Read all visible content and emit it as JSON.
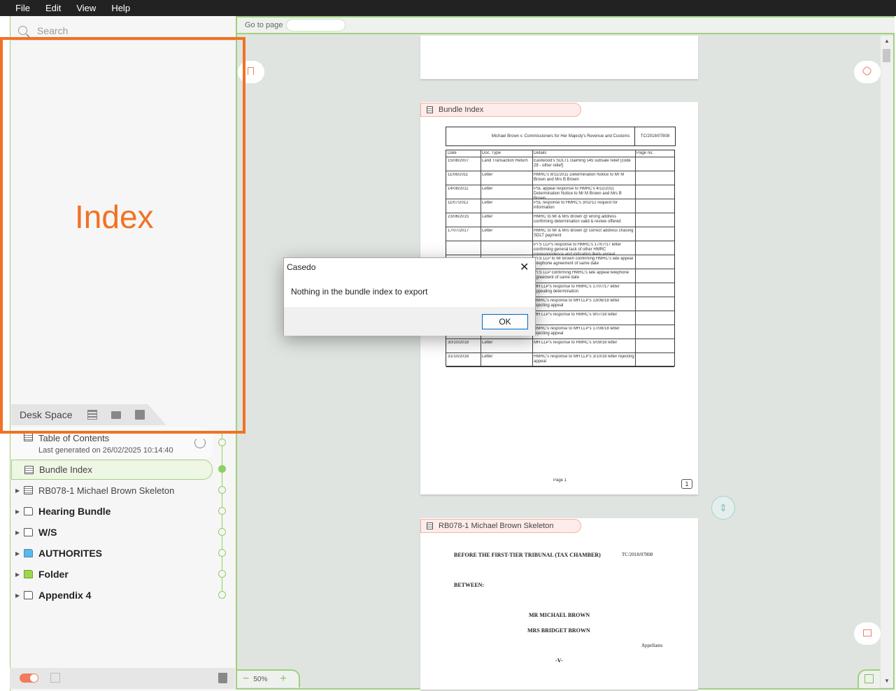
{
  "menu": [
    "File",
    "Edit",
    "View",
    "Help"
  ],
  "search": {
    "placeholder": "Search"
  },
  "overlay_label": "Index",
  "desk_space": {
    "label": "Desk Space"
  },
  "tree": {
    "toc": {
      "label": "Table of Contents",
      "subtitle": "Last generated on 26/02/2025 10:14:40"
    },
    "items": [
      {
        "label": "Bundle Index",
        "type": "doc",
        "selected": true
      },
      {
        "label": "RB078-1 Michael Brown Skeleton",
        "type": "doc"
      },
      {
        "label": "Hearing Bundle",
        "type": "folder"
      },
      {
        "label": "W/S",
        "type": "folder"
      },
      {
        "label": "AUTHORITES",
        "type": "folder",
        "color": "#5bb8e8"
      },
      {
        "label": "Folder",
        "type": "folder",
        "color": "#9fd74c"
      },
      {
        "label": "Appendix 4",
        "type": "folder"
      }
    ]
  },
  "viewer": {
    "goto_label": "Go to page",
    "zoom": "50%",
    "page1": {
      "tab_label": "Bundle Index",
      "scan_title": "Michael Brown v. Commissioners for Her Majesty's Revenue and Customs",
      "scan_ref": "TC/2018/07808",
      "columns": [
        "Date",
        "Doc. Type",
        "Details",
        "Page no."
      ],
      "rows": [
        {
          "date": "15/08/2007",
          "type": "Land Transaction Return",
          "details": "Eastwood's SDLT1 claiming s45 subsale relief [code 28 - other relief]"
        },
        {
          "date": "11/08/2011",
          "type": "Letter",
          "details": "HMRC's 8/11/2011 Determination Notice to Mr M Brown and Mrs B Brown"
        },
        {
          "date": "14/08/2011",
          "type": "Letter",
          "details": "PSL appeal response to HMRC's 4/11/2011 Determination Notice to Mr M Brown and Mrs B Brown"
        },
        {
          "date": "11/07/2012",
          "type": "Letter",
          "details": "PSL response to HMRC's 3/02/12 request for information"
        },
        {
          "date": "23/06/2015",
          "type": "Letter",
          "details": "HMRC to Mr & Mrs Brown @ wrong address confirming determination valid & review offered"
        },
        {
          "date": "17/07/2017",
          "type": "Letter",
          "details": "HMRC to Mr & Mrs Brown @ correct address chasing SDLT payment"
        },
        {
          "date": "",
          "type": "",
          "details": "PTS LLP's response to HMRC's 17/07/17 letter confirming general lack of other HMRC correspondence and indicating likely appeal"
        },
        {
          "date": "",
          "type": "",
          "details": "PTS LLP to Mr Brown confirming HMRC's late appeal telephone agreement of same date"
        },
        {
          "date": "",
          "type": "",
          "details": "PTS LLP confirming HMRC's late appeal telephone agreement of same date"
        },
        {
          "date": "",
          "type": "",
          "details": "MH LLP's response to HMRC's 17/07/17 letter appealing determination"
        },
        {
          "date": "",
          "type": "",
          "details": "HMRC's response to MH LLP's 13/06/18 letter rejecting appeal"
        },
        {
          "date": "",
          "type": "",
          "details": "MH LLP's response to HMRC's 9/07/18 letter"
        },
        {
          "date": "30/08/2018",
          "type": "Letter",
          "details": "HMRC's response to MH LLP's 17/08/18 letter rejecting appeal"
        },
        {
          "date": "30/10/2018",
          "type": "Letter",
          "details": "MH LLP's response to HMRC's 5/09/18 letter"
        },
        {
          "date": "31/10/2018",
          "type": "Letter",
          "details": "HMRC's response to MH LLP's 3/10/18 letter rejecting appeal"
        }
      ],
      "footer": "Page 1",
      "page_badge": "1"
    },
    "page2": {
      "tab_label": "RB078-1 Michael Brown Skeleton",
      "heading": "BEFORE THE FIRST-TIER TRIBUNAL (TAX CHAMBER)",
      "ref": "TC/2018/07808",
      "between": "BETWEEN:",
      "party1": "MR MICHAEL BROWN",
      "party2": "MRS BRIDGET BROWN",
      "role": "Appellants",
      "versus": "-V-"
    }
  },
  "dialog": {
    "title": "Casedo",
    "message": "Nothing in the bundle index to export",
    "ok_label": "OK"
  },
  "colors": {
    "accent_green": "#9fd07e",
    "highlight_orange": "#f07224",
    "tab_pink": "#fdecea"
  }
}
